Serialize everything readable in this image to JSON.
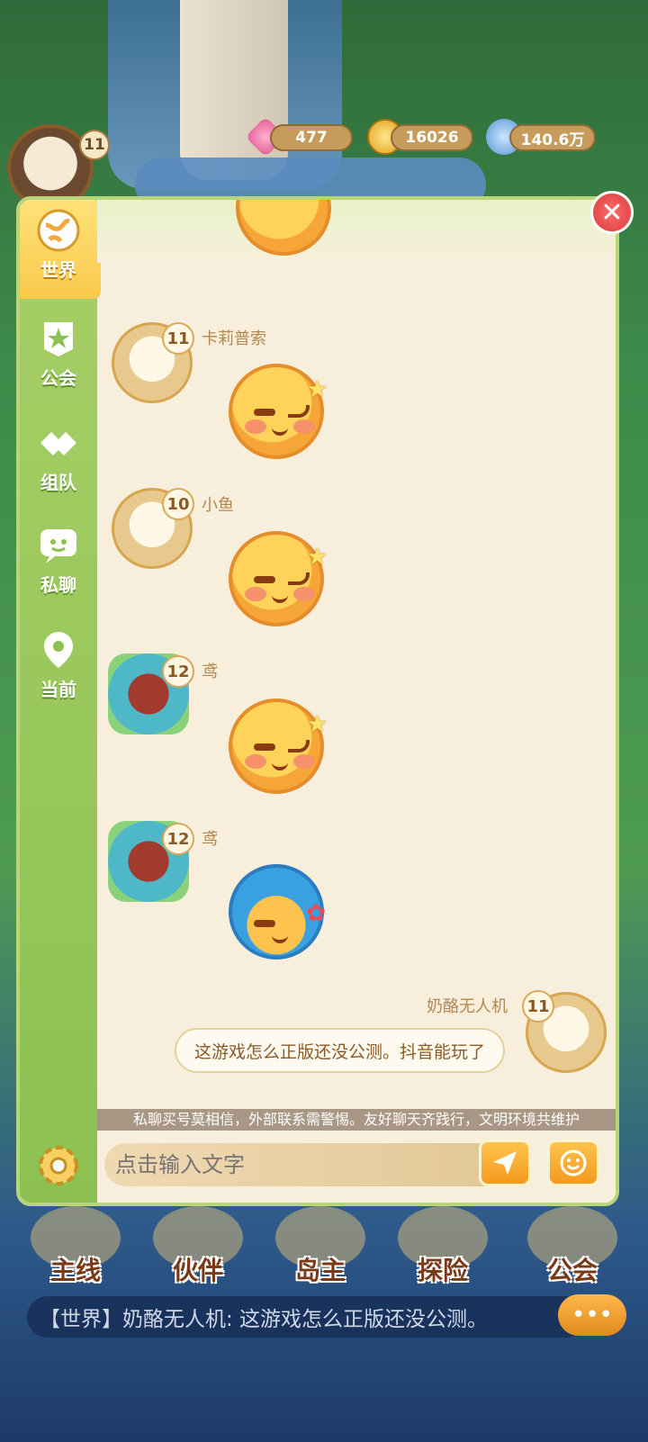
{
  "resources": {
    "gems": "477",
    "coins": "16026",
    "power": "140.6万"
  },
  "player": {
    "level": "11"
  },
  "tabs": [
    {
      "label": "世界",
      "icon": "globe-icon"
    },
    {
      "label": "公会",
      "icon": "guild-badge-icon"
    },
    {
      "label": "组队",
      "icon": "handshake-icon"
    },
    {
      "label": "私聊",
      "icon": "chat-bubble-icon"
    },
    {
      "label": "当前",
      "icon": "location-pin-icon"
    }
  ],
  "messages": [
    {
      "name": "卡莉普索",
      "level": "11",
      "type": "sticker"
    },
    {
      "name": "小鱼",
      "level": "10",
      "type": "sticker"
    },
    {
      "name": "鸢",
      "level": "12",
      "type": "sticker"
    },
    {
      "name": "鸢",
      "level": "12",
      "type": "sticker-hair"
    }
  ],
  "my_message": {
    "name": "奶酪无人机",
    "level": "11",
    "text": "这游戏怎么正版还没公测。抖音能玩了"
  },
  "notice": "私聊买号莫相信，外部联系需警惕。友好聊天齐践行，文明环境共维护",
  "input": {
    "placeholder": "点击输入文字"
  },
  "bottom_nav": [
    "主线",
    "伙伴",
    "岛主",
    "探险",
    "公会"
  ],
  "ticker": "【世界】奶酪无人机: 这游戏怎么正版还没公测。"
}
